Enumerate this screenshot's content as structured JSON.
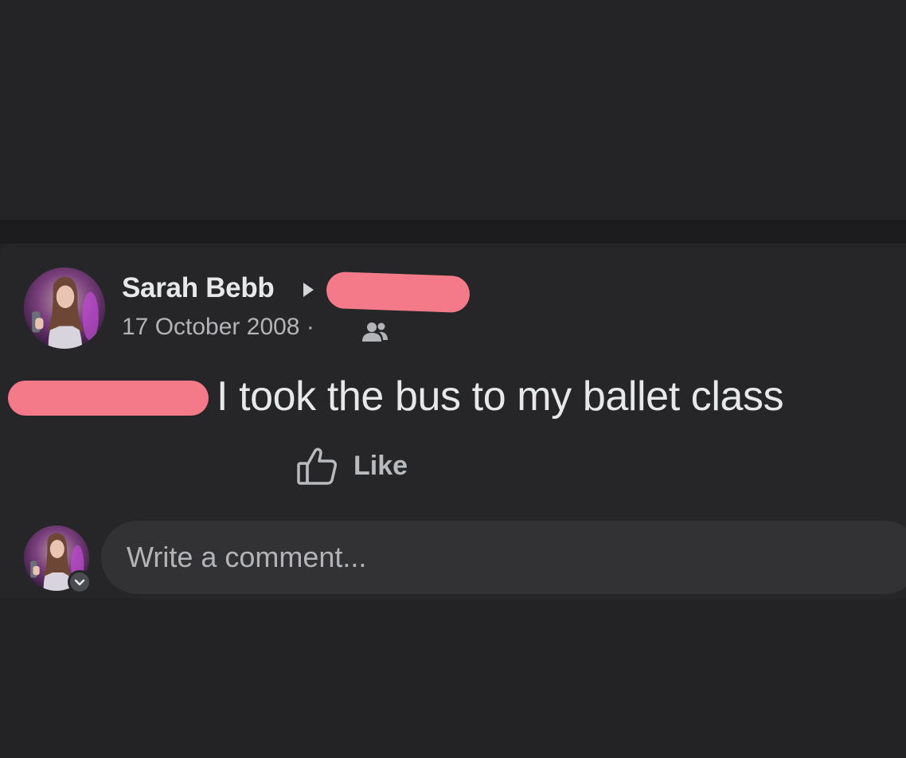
{
  "post": {
    "author_name": "Sarah Bebb",
    "date": "17 October 2008 ·",
    "body_text": "I took the bus to my ballet class",
    "like_label": "Like"
  },
  "comment": {
    "placeholder": "Write a comment..."
  },
  "icons": {
    "share_target_arrow": "caret-right-icon",
    "audience": "friends-icon",
    "like": "thumbs-up-icon",
    "avatar_menu": "chevron-down-icon"
  },
  "colors": {
    "background": "#232325",
    "card": "#262628",
    "primary_text": "#e7e8ea",
    "secondary_text": "#b2b4b8",
    "input_background": "#323235",
    "redaction": "#f47a8a"
  }
}
